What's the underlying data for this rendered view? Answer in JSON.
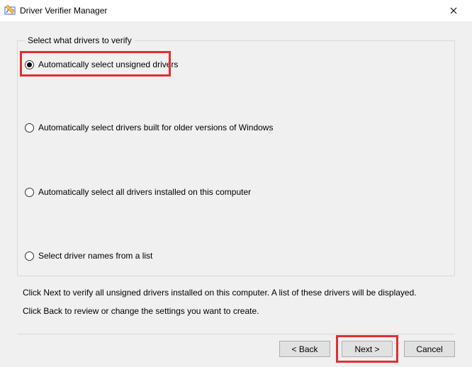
{
  "window": {
    "title": "Driver Verifier Manager"
  },
  "group": {
    "legend": "Select what drivers to verify",
    "options": [
      {
        "label": "Automatically select unsigned drivers",
        "checked": true
      },
      {
        "label": "Automatically select drivers built for older versions of Windows",
        "checked": false
      },
      {
        "label": "Automatically select all drivers installed on this computer",
        "checked": false
      },
      {
        "label": "Select driver names from a list",
        "checked": false
      }
    ]
  },
  "help": {
    "line1": "Click Next to verify all unsigned drivers installed on this computer. A list of these drivers will be displayed.",
    "line2": "Click Back to review or change the settings you want to create."
  },
  "buttons": {
    "back": "< Back",
    "next": "Next >",
    "cancel": "Cancel"
  }
}
